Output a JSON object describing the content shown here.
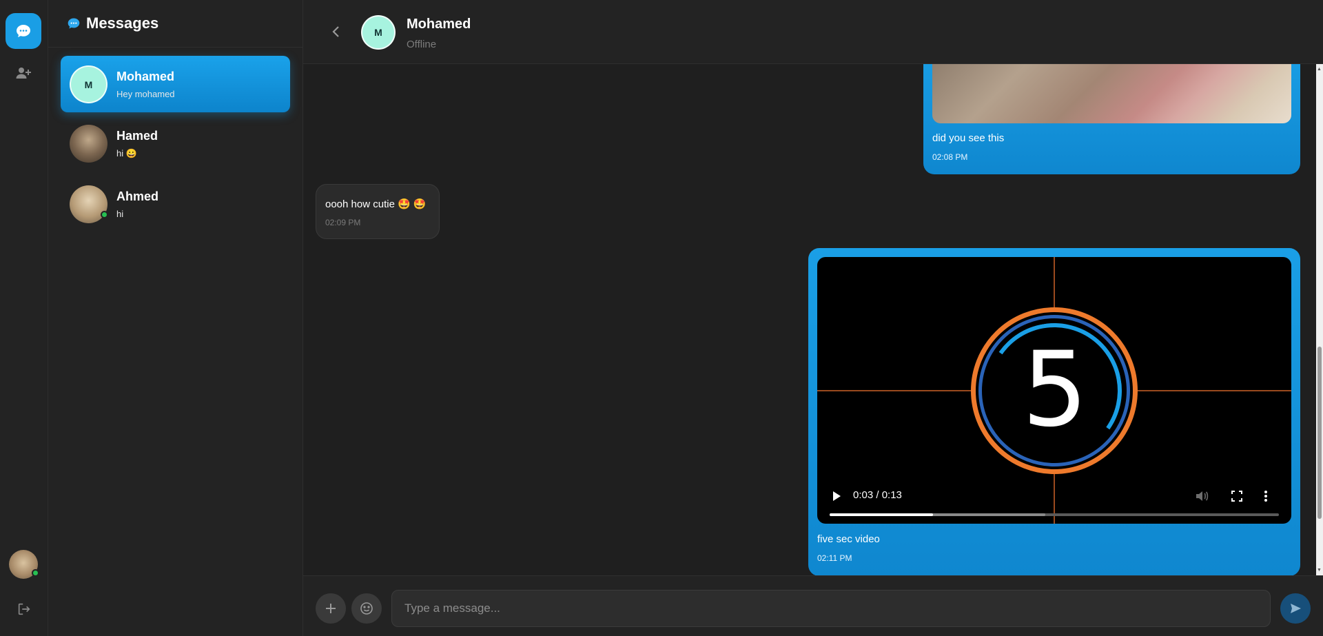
{
  "sidebar": {
    "title": "Messages",
    "conversations": [
      {
        "name": "Mohamed",
        "preview": "Hey mohamed",
        "avatar_letter": "M",
        "active": true
      },
      {
        "name": "Hamed",
        "preview": "hi 😀",
        "active": false
      },
      {
        "name": "Ahmed",
        "preview": "hi",
        "online": true,
        "active": false
      }
    ]
  },
  "chat": {
    "contact_name": "Mohamed",
    "contact_status": "Offline",
    "contact_avatar_letter": "M",
    "messages": [
      {
        "sender": "me",
        "type": "image",
        "text": "did you see this",
        "time": "02:08 PM"
      },
      {
        "sender": "them",
        "type": "text",
        "text": "oooh how cutie 🤩 🤩",
        "time": "02:09 PM"
      },
      {
        "sender": "me",
        "type": "video",
        "text": "five sec video",
        "time": "02:11 PM",
        "video": {
          "countdown_number": "5",
          "time_display": "0:03 / 0:13",
          "progress": 0.23,
          "buffered": 0.48
        }
      }
    ]
  },
  "composer": {
    "placeholder": "Type a message..."
  },
  "colors": {
    "accent": "#1a9ee5",
    "online": "#27c052",
    "background": "#1f1f1f"
  },
  "icons": {
    "rail": [
      "chat-bubble-icon",
      "add-user-icon",
      "logout-icon"
    ],
    "header": [
      "chevron-left-icon"
    ],
    "composer": [
      "plus-icon",
      "emoji-icon",
      "send-icon"
    ],
    "video": [
      "play-icon",
      "volume-icon",
      "fullscreen-icon",
      "more-vertical-icon"
    ]
  }
}
